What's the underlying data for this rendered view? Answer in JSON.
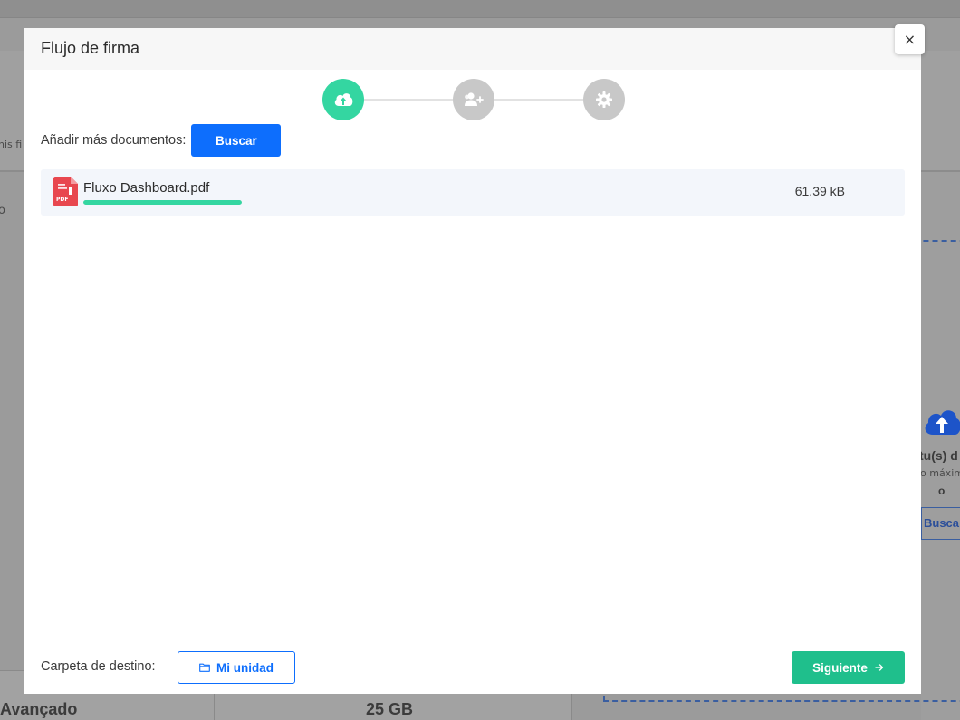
{
  "modal": {
    "title": "Flujo de firma",
    "close_label": "×"
  },
  "stepper": {
    "steps": [
      {
        "icon": "cloud-upload-icon",
        "state": "active"
      },
      {
        "icon": "add-user-icon",
        "state": "inactive"
      },
      {
        "icon": "gear-icon",
        "state": "inactive"
      }
    ]
  },
  "add_documents": {
    "label": "Añadir más documentos:",
    "button_label": "Buscar"
  },
  "files": [
    {
      "name": "Fluxo Dashboard.pdf",
      "size": "61.39 kB",
      "progress": 1.0,
      "icon": "pdf-file-icon"
    }
  ],
  "footer": {
    "destination_label": "Carpeta de destino:",
    "destination_button": "Mi unidad",
    "next_button": "Siguiente"
  },
  "background": {
    "left_fragment_1": "nis fi",
    "left_fragment_2": "o",
    "upload_title_fragment": "tu(s) d",
    "upload_sub_fragment": "o máxim",
    "upload_mark": "o",
    "upload_link_fragment": "Busca",
    "plan_name": "Avançado",
    "storage_value": "25 GB"
  },
  "colors": {
    "accent_green": "#34d6a1",
    "primary_blue": "#0d6efd",
    "next_green": "#1fbf8c"
  }
}
